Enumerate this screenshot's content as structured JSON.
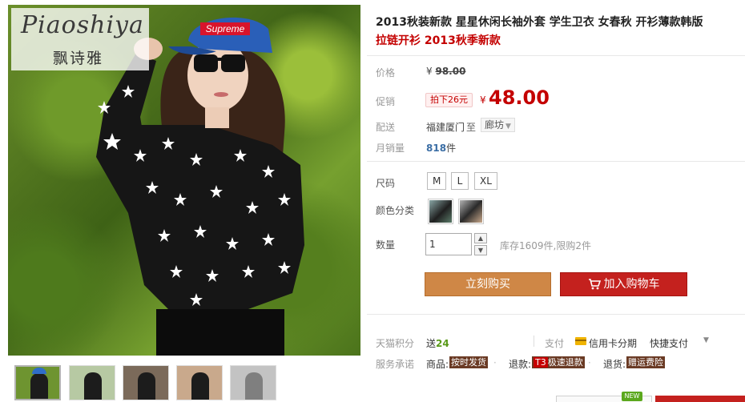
{
  "brand": {
    "script_name": "Piaoshiya",
    "cn_name": "飘诗雅"
  },
  "hat_text": "Supreme",
  "product": {
    "title": "2013秋装新款 星星休闲长袖外套 学生卫衣 女春秋 开衫薄款韩版",
    "subtitle": "拉链开衫 2013秋季新款"
  },
  "price": {
    "label": "价格",
    "currency": "¥",
    "original": "98.00"
  },
  "promo": {
    "label": "促销",
    "tag": "拍下26元",
    "currency": "¥",
    "price": "48.00"
  },
  "shipping": {
    "label": "配送",
    "from": "福建厦门",
    "to_word": "至",
    "to": "廊坊"
  },
  "sales": {
    "label": "月销量",
    "count": "818",
    "unit": "件"
  },
  "size": {
    "label": "尺码",
    "options": [
      "M",
      "L",
      "XL"
    ]
  },
  "color": {
    "label": "颜色分类"
  },
  "quantity": {
    "label": "数量",
    "value": "1",
    "stock": "库存1609件,限购2件"
  },
  "actions": {
    "buy": "立刻购买",
    "cart": "加入购物车"
  },
  "points": {
    "label": "天猫积分",
    "prefix": "送",
    "value": "24"
  },
  "payment": {
    "label": "支付",
    "credit": "信用卡分期",
    "quick": "快捷支付"
  },
  "service": {
    "label": "服务承诺",
    "items": [
      {
        "key": "商品:",
        "tag": "按时发货"
      },
      {
        "key": "退款:",
        "tag_prefix": "T3",
        "tag": "极速退款"
      },
      {
        "key": "退货:",
        "tag": "赠运费险"
      }
    ]
  },
  "new_badge": "NEW",
  "colors": {
    "accent_red": "#c40000",
    "buy_button": "#cf8746",
    "cart_button": "#c4211e",
    "sales_blue": "#3b6ea5",
    "points_green": "#5a9a1a"
  }
}
